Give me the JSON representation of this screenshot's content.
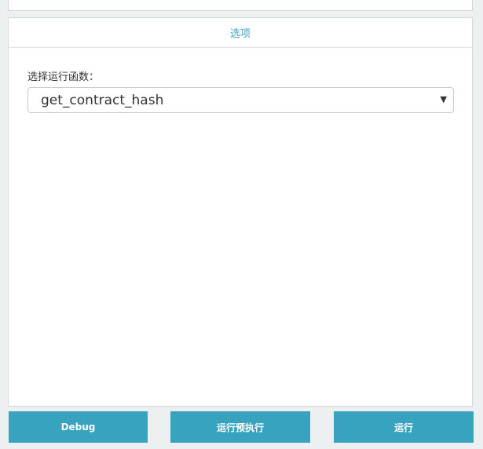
{
  "options_panel": {
    "title": "选项"
  },
  "function_select": {
    "label": "选择运行函数：",
    "selected": "get_contract_hash",
    "arrow": "▼"
  },
  "actions": {
    "debug_label": "Debug",
    "preexecute_label": "运行预执行",
    "run_label": "运行"
  },
  "colors": {
    "accent": "#37a3bf",
    "title_text": "#3fa3c0",
    "background": "#edf0f1"
  }
}
